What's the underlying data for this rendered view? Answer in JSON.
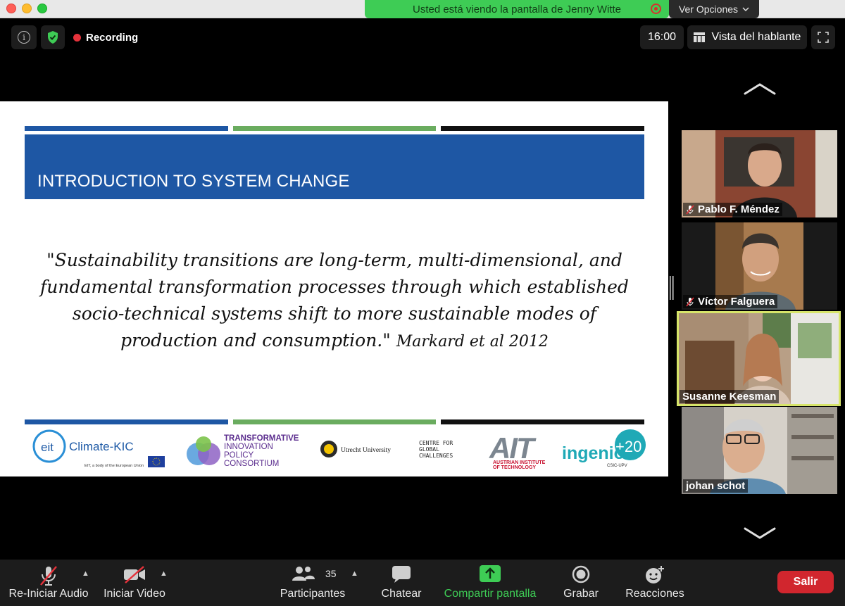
{
  "share_banner": {
    "text": "Usted está viendo la pantalla de Jenny Witte"
  },
  "view_options": {
    "label": "Ver Opciones"
  },
  "top_bar": {
    "recording_label": "Recording",
    "timer": "16:00",
    "speaker_view_label": "Vista del hablante"
  },
  "slide": {
    "title": "INTRODUCTION TO SYSTEM CHANGE",
    "quote": "\"Sustainability transitions are long-term, multi-dimensional, and fundamental transformation processes through which established socio-technical systems shift to more sustainable modes of production and consumption.\"",
    "citation": "Markard et al 2012",
    "colors": {
      "blue": "#1e57a4",
      "green": "#6aac5f",
      "black": "#111111"
    },
    "logos": {
      "climate_kic": {
        "name": "Climate-KIC",
        "tagline": "EIT, a body of the European Union"
      },
      "tipc": {
        "lines": [
          "TRANSFORMATIVE",
          "INNOVATION",
          "POLICY",
          "CONSORTIUM"
        ]
      },
      "utrecht": {
        "name": "Utrecht University"
      },
      "cgc": {
        "lines": [
          "CENTRE FOR",
          "GLOBAL",
          "CHALLENGES"
        ]
      },
      "ait": {
        "name": "AIT",
        "lines": [
          "AUSTRIAN INSTITUTE",
          "OF TECHNOLOGY"
        ]
      },
      "ingenio": {
        "name": "ingenio",
        "badge": "+20",
        "sub": "CSIC-UPV"
      }
    }
  },
  "participants": [
    {
      "name": "Pablo F. Méndez",
      "muted": true,
      "active": false
    },
    {
      "name": "Víctor Falguera",
      "muted": true,
      "active": false
    },
    {
      "name": "Susanne Keesman",
      "muted": false,
      "active": true
    },
    {
      "name": "johan schot",
      "muted": false,
      "active": false
    }
  ],
  "toolbar": {
    "audio_label": "Re-Iniciar Audio",
    "video_label": "Iniciar Video",
    "participants_label": "Participantes",
    "participants_count": "35",
    "chat_label": "Chatear",
    "share_label": "Compartir pantalla",
    "record_label": "Grabar",
    "reactions_label": "Reacciones",
    "exit_label": "Salir"
  }
}
